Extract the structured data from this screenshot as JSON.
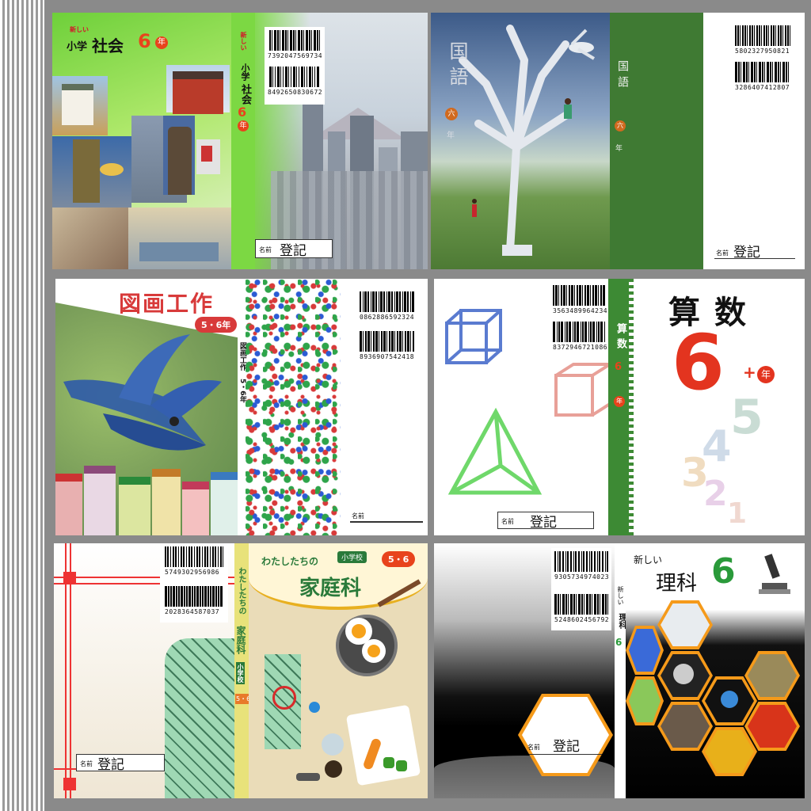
{
  "covers": {
    "social": {
      "prefix": "新しい",
      "series": "小学",
      "subject": "社会",
      "grade_num": "6",
      "grade_unit": "年",
      "spine_prefix": "新しい",
      "spine_series": "小学",
      "spine_subject": "社会",
      "spine_grade": "6",
      "spine_unit": "年",
      "barcode1": "7392047569734",
      "barcode2": "8492650830672",
      "name_label": "名前",
      "register": "登記"
    },
    "japanese": {
      "subject": "国語",
      "grade": "六",
      "grade_unit": "年",
      "spine_subject": "国語",
      "spine_grade": "六",
      "spine_unit": "年",
      "barcode1": "5802327950821",
      "barcode2": "3286407412807",
      "name_label": "名前",
      "register": "登記"
    },
    "art": {
      "subject": "図画工作",
      "grade": "5・6年",
      "spine_title": "図画工作",
      "spine_grade": "5・6年",
      "barcode1": "0862886592324",
      "barcode2": "8936907542418",
      "name_label": "名前"
    },
    "math": {
      "subject": "算数",
      "grade_num": "6",
      "grade_unit": "年",
      "spine_subject": "算数",
      "spine_grade": "6",
      "spine_unit": "年",
      "barcode1": "3563489964234",
      "barcode2": "8372946721086",
      "digits": [
        "5",
        "4",
        "3",
        "2",
        "1"
      ],
      "name_label": "名前",
      "register": "登記"
    },
    "home": {
      "prefix": "わたしたちの",
      "badge": "小学校",
      "grade": "5・6",
      "subject": "家庭科",
      "spine_prefix": "わたしたちの",
      "spine_subject": "家庭科",
      "spine_badge": "小学校",
      "spine_grade": "5・6",
      "barcode1": "5749302956986",
      "barcode2": "2028364587037",
      "name_label": "名前",
      "register": "登記"
    },
    "science": {
      "prefix": "新しい",
      "subject": "理科",
      "grade_num": "6",
      "spine_prefix": "新しい",
      "spine_subject": "理科",
      "spine_grade": "6",
      "barcode1": "9305734974023",
      "barcode2": "5248602456792",
      "name_label": "名前",
      "register": "登記"
    }
  }
}
